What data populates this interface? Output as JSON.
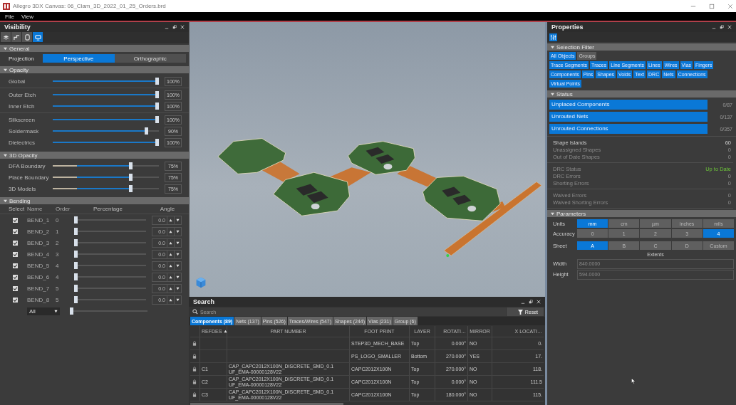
{
  "window": {
    "title": "Allegro 3DX Canvas: 06_Clam_3D_2022_01_25_Orders.brd",
    "menu": [
      "File",
      "View"
    ]
  },
  "visibility": {
    "title": "Visibility",
    "view_tabs": [
      {
        "kind": "layers",
        "selected": false
      },
      {
        "kind": "trace",
        "selected": false
      },
      {
        "kind": "outline",
        "selected": false
      },
      {
        "kind": "display",
        "selected": true
      }
    ],
    "general": {
      "title": "General",
      "projection_label": "Projection",
      "options": [
        {
          "label": "Perspective",
          "selected": true
        },
        {
          "label": "Orthographic",
          "selected": false
        }
      ]
    },
    "opacity": {
      "title": "Opacity",
      "groups": [
        [
          {
            "name": "Global",
            "level": 1,
            "reading": "100%"
          }
        ],
        [
          {
            "name": "Outer Etch",
            "level": 1,
            "reading": "100%"
          },
          {
            "name": "Inner Etch",
            "level": 1,
            "reading": "100%"
          }
        ],
        [
          {
            "name": "Silkscreen",
            "level": 1,
            "reading": "100%"
          },
          {
            "name": "Soldermask",
            "level": 0.9,
            "reading": "90%"
          },
          {
            "name": "Dielectrics",
            "level": 1,
            "reading": "100%"
          }
        ]
      ]
    },
    "opacity_3d": {
      "title": "3D Opacity",
      "sliders": [
        {
          "name": "DFA Boundary",
          "level": 0.75,
          "reading": "75%"
        },
        {
          "name": "Place Boundary",
          "level": 0.75,
          "reading": "75%"
        },
        {
          "name": "3D Models",
          "level": 0.75,
          "reading": "75%"
        }
      ]
    },
    "bending": {
      "title": "Bending",
      "columns": [
        "Select",
        "Name",
        "Order",
        "Percentage",
        "Angle"
      ],
      "rows": [
        {
          "checked": true,
          "name": "BEND_1",
          "order": "0",
          "level": 0,
          "angle": "0.0"
        },
        {
          "checked": true,
          "name": "BEND_2",
          "order": "1",
          "level": 0,
          "angle": "0.0"
        },
        {
          "checked": true,
          "name": "BEND_3",
          "order": "2",
          "level": 0,
          "angle": "0.0"
        },
        {
          "checked": true,
          "name": "BEND_4",
          "order": "3",
          "level": 0,
          "angle": "0.0"
        },
        {
          "checked": true,
          "name": "BEND_5",
          "order": "4",
          "level": 0,
          "angle": "0.0"
        },
        {
          "checked": true,
          "name": "BEND_6",
          "order": "4",
          "level": 0,
          "angle": "0.0"
        },
        {
          "checked": true,
          "name": "BEND_7",
          "order": "5",
          "level": 0,
          "angle": "0.0"
        },
        {
          "checked": true,
          "name": "BEND_8",
          "order": "5",
          "level": 0,
          "angle": "0.0"
        }
      ],
      "footer": {
        "value": "All",
        "level": 0
      }
    }
  },
  "search": {
    "title": "Search",
    "placeholder": "Search",
    "reset": "Reset",
    "tabs": [
      {
        "label": "Components (89)",
        "selected": true
      },
      {
        "label": "Nets (137)",
        "selected": false
      },
      {
        "label": "Pins (526)",
        "selected": false
      },
      {
        "label": "Traces/Wires (547)",
        "selected": false
      },
      {
        "label": "Shapes (244)",
        "selected": false
      },
      {
        "label": "Vias (231)",
        "selected": false
      },
      {
        "label": "Group (6)",
        "selected": false
      }
    ],
    "columns": [
      {
        "label": "REFDES",
        "sorted": true
      },
      {
        "label": "PART NUMBER",
        "sorted": false
      },
      {
        "label": "FOOT PRINT",
        "sorted": false
      },
      {
        "label": "LAYER",
        "sorted": false
      },
      {
        "label": "ROTATI…",
        "sorted": false
      },
      {
        "label": "MIRROR",
        "sorted": false
      },
      {
        "label": "X LOCATI…",
        "sorted": false
      }
    ],
    "rows": [
      {
        "locked": true,
        "footprint": "STEP3D_MECH_BASE",
        "layer": "Top",
        "rotation": "0.000°",
        "mirror": "NO",
        "x_location": "0."
      },
      {
        "locked": true,
        "footprint": "PS_LOGO_SMALLER",
        "layer": "Bottom",
        "rotation": "270.000°",
        "mirror": "YES",
        "x_location": "17."
      },
      {
        "locked": true,
        "refdes": "C1",
        "part_number": "CAP_CAPC2012X100N_DISCRETE_SMD_0.1 UF_EMA-00000128V22",
        "footprint": "CAPC2012X100N",
        "layer": "Top",
        "rotation": "270.000°",
        "mirror": "NO",
        "x_location": "118."
      },
      {
        "locked": true,
        "refdes": "C2",
        "part_number": "CAP_CAPC2012X100N_DISCRETE_SMD_0.1 UF_EMA-00000128V22",
        "footprint": "CAPC2012X100N",
        "layer": "Top",
        "rotation": "0.000°",
        "mirror": "NO",
        "x_location": "111.5"
      },
      {
        "locked": true,
        "refdes": "C3",
        "part_number": "CAP_CAPC2012X100N_DISCRETE_SMD_0.1 UF_EMA-00000128V22",
        "footprint": "CAPC2012X100N",
        "layer": "Top",
        "rotation": "180.000°",
        "mirror": "NO",
        "x_location": "115."
      }
    ]
  },
  "properties": {
    "title": "Properties",
    "filter": {
      "title": "Selection Filter",
      "scopes": [
        {
          "label": "All Objects",
          "selected": true
        },
        {
          "label": "Groups",
          "selected": false
        }
      ],
      "types": [
        {
          "label": "Trace Segments",
          "selected": true
        },
        {
          "label": "Traces",
          "selected": true
        },
        {
          "label": "Line Segments",
          "selected": true
        },
        {
          "label": "Lines",
          "selected": true
        },
        {
          "label": "Wires",
          "selected": true
        },
        {
          "label": "Vias",
          "selected": true
        },
        {
          "label": "Fingers",
          "selected": true
        },
        {
          "label": "Components",
          "selected": true
        },
        {
          "label": "Pins",
          "selected": true
        },
        {
          "label": "Shapes",
          "selected": true
        },
        {
          "label": "Voids",
          "selected": true
        },
        {
          "label": "Text",
          "selected": true
        },
        {
          "label": "DRC",
          "selected": true
        },
        {
          "label": "Nets",
          "selected": true
        },
        {
          "label": "Connections",
          "selected": true
        },
        {
          "label": "Virtual Points",
          "selected": true
        }
      ]
    },
    "status": {
      "title": "Status",
      "bars": [
        {
          "label": "Unplaced Components",
          "level": 1,
          "reading": "0/87"
        },
        {
          "label": "Unrouted Nets",
          "level": 1,
          "reading": "0/137"
        },
        {
          "label": "Unrouted Connections",
          "level": 1,
          "reading": "0/357"
        }
      ],
      "groups": [
        [
          {
            "label": "Shape Islands",
            "value": "60",
            "dim": false,
            "ok": false
          },
          {
            "label": "Unassigned Shapes",
            "value": "0",
            "dim": true,
            "ok": false
          },
          {
            "label": "Out of Date Shapes",
            "value": "0",
            "dim": true,
            "ok": false
          }
        ],
        [
          {
            "label": "DRC Status",
            "value": "Up to Date",
            "dim": true,
            "ok": true
          },
          {
            "label": "DRC Errors",
            "value": "0",
            "dim": true,
            "ok": false
          },
          {
            "label": "Shorting Errors",
            "value": "0",
            "dim": true,
            "ok": false
          }
        ],
        [
          {
            "label": "Waived Errors",
            "value": "0",
            "dim": true,
            "ok": false
          },
          {
            "label": "Waived Shorting Errors",
            "value": "0",
            "dim": true,
            "ok": false
          }
        ]
      ]
    },
    "parameters": {
      "title": "Parameters",
      "rows": [
        {
          "label": "Units",
          "options": [
            {
              "label": "mm",
              "selected": true
            },
            {
              "label": "cm",
              "selected": false
            },
            {
              "label": "µm",
              "selected": false
            },
            {
              "label": "inches",
              "selected": false
            },
            {
              "label": "mils",
              "selected": false
            }
          ]
        },
        {
          "label": "Accuracy",
          "options": [
            {
              "label": "0",
              "selected": false
            },
            {
              "label": "1",
              "selected": false
            },
            {
              "label": "2",
              "selected": false
            },
            {
              "label": "3",
              "selected": false
            },
            {
              "label": "4",
              "selected": true
            }
          ]
        },
        {
          "label": "Sheet",
          "options": [
            {
              "label": "A",
              "selected": true
            },
            {
              "label": "B",
              "selected": false
            },
            {
              "label": "C",
              "selected": false
            },
            {
              "label": "D",
              "selected": false
            },
            {
              "label": "Custom",
              "selected": false
            }
          ]
        }
      ],
      "extents": "Extents",
      "fields": [
        {
          "label": "Width",
          "value": "840.0000",
          "disabled": true
        },
        {
          "label": "Height",
          "value": "594.0000",
          "disabled": true
        }
      ]
    }
  }
}
